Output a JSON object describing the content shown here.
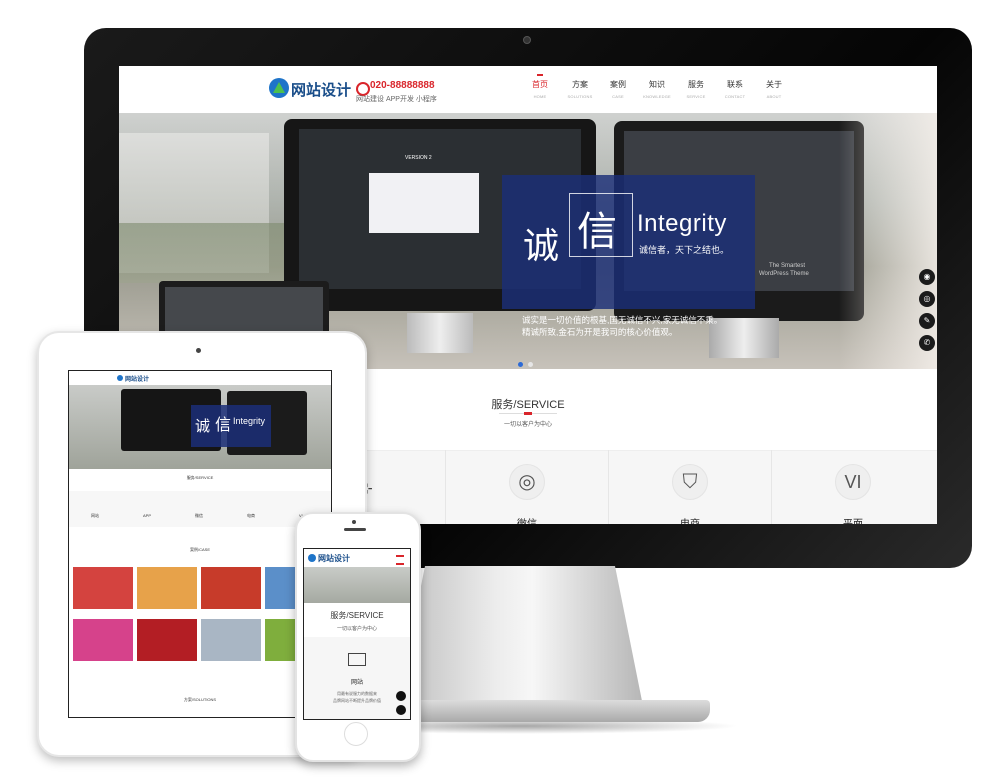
{
  "site": {
    "logo_text": "网站设计",
    "phone": "020-88888888",
    "phone_sub": "网站建设 APP开发 小程序",
    "nav": [
      {
        "cn": "首页",
        "en": "HOME",
        "active": true
      },
      {
        "cn": "方案",
        "en": "SOLUTIONS",
        "active": false
      },
      {
        "cn": "案例",
        "en": "CASE",
        "active": false
      },
      {
        "cn": "知识",
        "en": "KNOWLEDGE",
        "active": false
      },
      {
        "cn": "服务",
        "en": "SERVICE",
        "active": false
      },
      {
        "cn": "联系",
        "en": "CONTACT",
        "active": false
      },
      {
        "cn": "关于",
        "en": "ABOUT",
        "active": false
      }
    ]
  },
  "hero": {
    "cn1": "诚",
    "cn2": "信",
    "en": "Integrity",
    "sub": "诚信者，天下之结也。",
    "p1": "诚实是一切价值的根基,国无诚信不兴,家无诚信不乘。",
    "p2": "精诚所致,金石为开是我司的核心价值观。",
    "screen_version": "VERSION 2",
    "screen_right_text1": "The Smartest",
    "screen_right_text2": "WordPress Theme"
  },
  "side_icons": [
    "qq-icon",
    "wechat-icon",
    "edit-icon",
    "phone-icon"
  ],
  "services": {
    "title": "服务/SERVICE",
    "subtitle": "一切以客户为中心",
    "items": [
      {
        "name": "",
        "icon": "network-icon",
        "glyph": ""
      },
      {
        "name": "微信",
        "icon": "wechat-icon",
        "glyph": "◎"
      },
      {
        "name": "电商",
        "icon": "shopping-bag-icon",
        "glyph": "⛉"
      },
      {
        "name": "平面",
        "icon": "vi-icon",
        "glyph": "VI"
      }
    ]
  },
  "ipad": {
    "logo_text": "网站设计",
    "hero_cn1": "诚",
    "hero_cn2": "信",
    "hero_en": "Integrity",
    "service_title": "服务/SERVICE",
    "service_items": [
      "网站",
      "APP",
      "微信",
      "电商",
      "VI"
    ],
    "case_title": "案例/CASE",
    "solutions_title": "方案/SOLUTIONS"
  },
  "iphone": {
    "logo_text": "网站设计",
    "service_title": "服务/SERVICE",
    "service_sub": "一切以客户为中心",
    "item_name": "网站",
    "item_desc1": "用最有说服力的数据来",
    "item_desc2": "品牌网站不断提升品牌价值"
  },
  "colors": {
    "accent_red": "#d9252b",
    "hero_blue": "#1b2e78",
    "logo_blue": "#1e74c9"
  }
}
